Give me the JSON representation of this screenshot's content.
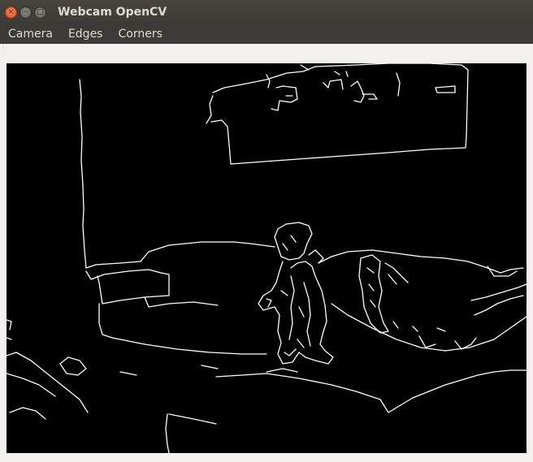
{
  "window": {
    "title": "Webcam OpenCV",
    "controls": {
      "close": "×",
      "minimize": "−",
      "maximize": "□"
    }
  },
  "menu": {
    "items": [
      "Camera",
      "Edges",
      "Corners"
    ]
  },
  "frame": {
    "content": "canny-edge-detection-output",
    "background": "#000000",
    "edge_color": "#ffffff"
  },
  "colors": {
    "titlebar": "#3c3b37",
    "window_bg": "#f2f1f0",
    "close_button": "#e95420",
    "title_text": "#dfdbd2"
  }
}
